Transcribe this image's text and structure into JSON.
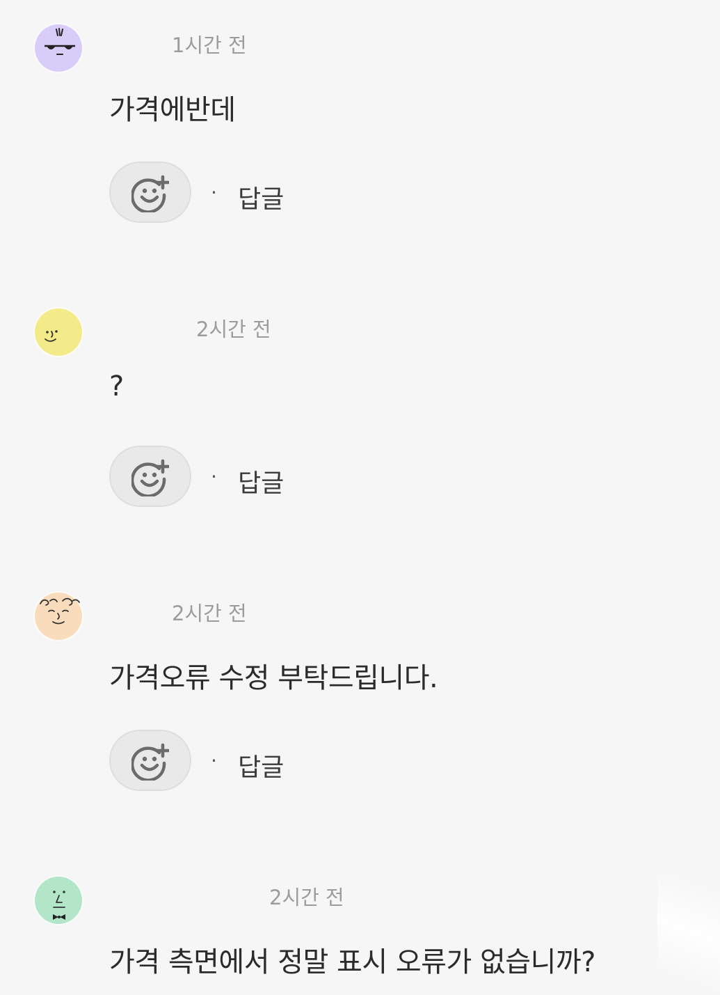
{
  "comments": [
    {
      "avatar_icon": "sunglasses-face-avatar",
      "avatar_color": "#d8cdf8",
      "timestamp": "1시간 전",
      "text": "가격에반데",
      "reply_label": "답글",
      "separator": "·"
    },
    {
      "avatar_icon": "smiling-face-avatar",
      "avatar_color": "#f3ea8a",
      "timestamp": "2시간 전",
      "text": "?",
      "reply_label": "답글",
      "separator": "·"
    },
    {
      "avatar_icon": "curly-hair-face-avatar",
      "avatar_color": "#f8dcbc",
      "timestamp": "2시간 전",
      "text": "가격오류 수정 부탁드립니다.",
      "reply_label": "답글",
      "separator": "·"
    },
    {
      "avatar_icon": "bowtie-face-avatar",
      "avatar_color": "#b3e6c8",
      "timestamp": "2시간 전",
      "text": "가격 측면에서 정말 표시 오류가 없습니까?"
    }
  ],
  "icons": {
    "reaction": "add-reaction-smiley-icon"
  }
}
